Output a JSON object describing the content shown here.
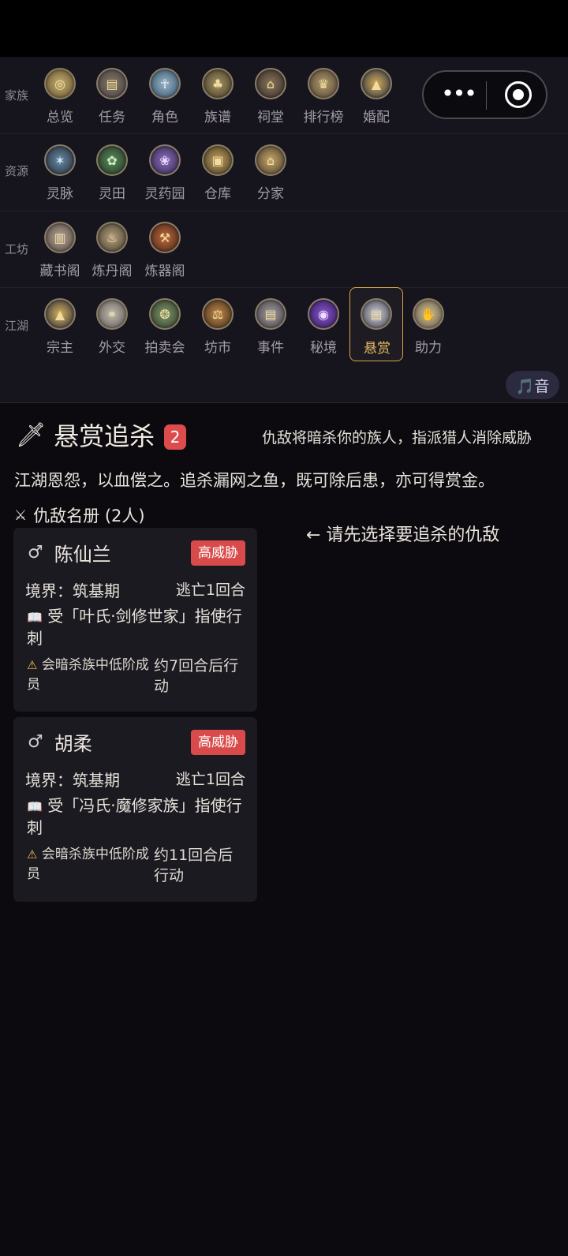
{
  "capsule": {
    "more_icon": "more-dots-icon",
    "close_icon": "target-icon"
  },
  "nav_rows": [
    {
      "label": "家族",
      "items": [
        "总览",
        "任务",
        "角色",
        "族谱",
        "祠堂",
        "排行榜",
        "婚配"
      ]
    },
    {
      "label": "资源",
      "items": [
        "灵脉",
        "灵田",
        "灵药园",
        "仓库",
        "分家"
      ]
    },
    {
      "label": "工坊",
      "items": [
        "藏书阁",
        "炼丹阁",
        "炼器阁"
      ]
    },
    {
      "label": "江湖",
      "items": [
        "宗主",
        "外交",
        "拍卖会",
        "坊市",
        "事件",
        "秘境",
        "悬赏",
        "助力"
      ]
    }
  ],
  "active_item": "悬赏",
  "music_button": "🎵音",
  "header": {
    "title": "悬赏追杀",
    "badge": "2",
    "subtitle": "仇敌将暗杀你的族人，指派猎人消除威胁"
  },
  "description": "江湖恩怨，以血偿之。追杀漏网之鱼，既可除后患，亦可得赏金。",
  "list_title": "仇敌名册 (2人)",
  "hint": "← 请先选择要追杀的仇敌",
  "enemies": [
    {
      "name": "陈仙兰",
      "threat": "高威胁",
      "realm": "境界：筑基期",
      "escape": "逃亡1回合",
      "sponsor": "受「叶氏·剑修世家」指使行刺",
      "warning": "会暗杀族中低阶成员",
      "eta": "约7回合后行动"
    },
    {
      "name": "胡柔",
      "threat": "高威胁",
      "realm": "境界：筑基期",
      "escape": "逃亡1回合",
      "sponsor": "受「冯氏·魔修家族」指使行刺",
      "warning": "会暗杀族中低阶成员",
      "eta": "约11回合后行动"
    }
  ],
  "colors": {
    "accent": "#d6a64c",
    "threat": "#d94b4b",
    "badge": "#dd4c4c",
    "background": "#0c0a0f",
    "nav_background": "#16141c"
  }
}
